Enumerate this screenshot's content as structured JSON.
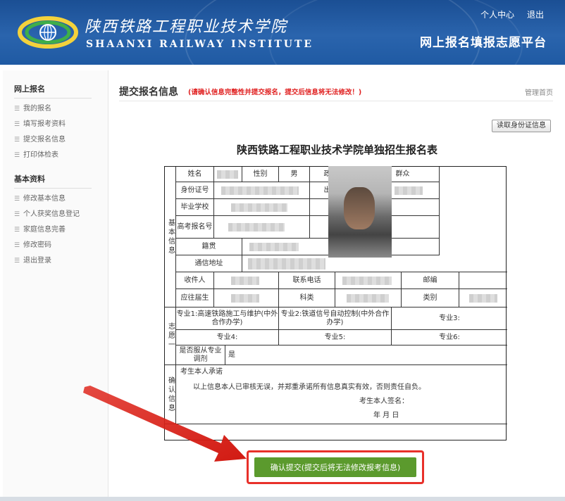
{
  "header": {
    "school_name_cn": "陕西铁路工程职业技术学院",
    "school_name_en": "SHAANXI RAILWAY INSTITUTE",
    "platform_title": "网上报名填报志愿平台",
    "links": [
      "个人中心",
      "退出"
    ]
  },
  "sidebar": {
    "sections": [
      {
        "title": "网上报名",
        "items": [
          "我的报名",
          "填写报考资料",
          "提交报名信息",
          "打印体检表"
        ]
      },
      {
        "title": "基本资料",
        "items": [
          "修改基本信息",
          "个人获奖信息登记",
          "家庭信息完善",
          "修改密码",
          "退出登录"
        ]
      }
    ]
  },
  "main": {
    "title": "提交报名信息",
    "warning": "(请确认信息完整性并提交报名，提交后信息将无法修改！)",
    "manage_home": "管理首页",
    "read_id_button": "读取身份证信息",
    "form_title": "陕西铁路工程职业技术学院单独招生报名表",
    "submit_button": "确认提交(提交后将无法修改报考信息)"
  },
  "form": {
    "section_basic": "基本信息",
    "section_wish": "志愿一",
    "section_confirm": "确认信息",
    "labels": {
      "name": "姓名",
      "gender": "性别",
      "gender_value": "男",
      "political": "政治面貌",
      "political_value": "群众",
      "id_number": "身份证号",
      "birth": "出生年月",
      "school": "毕业学校",
      "height": "身高",
      "exam_no": "高考报名号",
      "weight": "体重",
      "native": "籍贯",
      "address": "通信地址",
      "receiver": "收件人",
      "phone": "联系电话",
      "postcode": "邮编",
      "grad_type": "应往届生",
      "subject": "科类",
      "category": "类别"
    },
    "majors": {
      "m1": "专业1:高速铁路施工与维护(中外合作办学)",
      "m2": "专业2:铁道信号自动控制(中外合作办学)",
      "m3": "专业3:",
      "m4": "专业4:",
      "m5": "专业5:",
      "m6": "专业6:",
      "obey": "是否服从专业调剂",
      "obey_value": "是"
    },
    "confirm": {
      "heading": "考生本人承诺",
      "statement": "以上信息本人已审核无误，并郑重承诺所有信息真实有效，否则责任自负。",
      "signature": "考生本人签名：",
      "date": "年  月  日"
    }
  }
}
